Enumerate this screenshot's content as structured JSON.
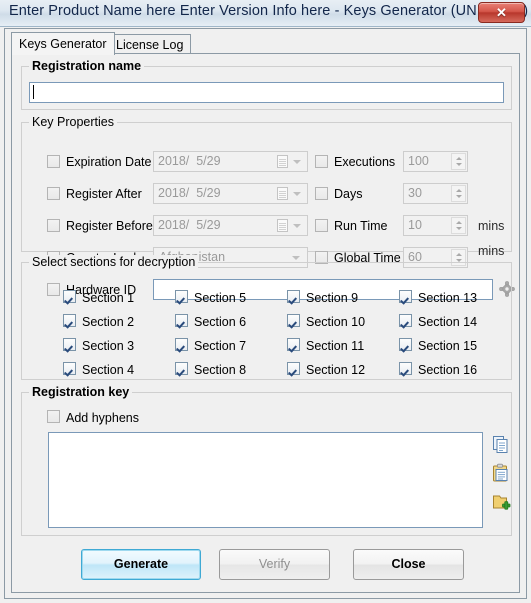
{
  "window": {
    "title": "Enter Product Name here Enter Version Info here - Keys Generator (UNICODE)",
    "close_label": "✕"
  },
  "tabs": [
    {
      "label": "Keys Generator",
      "active": true
    },
    {
      "label": "License Log",
      "active": false
    }
  ],
  "registration_name": {
    "group_title": "Registration name",
    "value": "",
    "placeholder": ""
  },
  "key_properties": {
    "group_title": "Key Properties",
    "left_rows": [
      {
        "label": "Expiration Date",
        "checked": false,
        "control": "datepicker",
        "value": "2018/  5/29"
      },
      {
        "label": "Register After",
        "checked": false,
        "control": "datepicker",
        "value": "2018/  5/29"
      },
      {
        "label": "Register Before",
        "checked": false,
        "control": "datepicker",
        "value": "2018/  5/29"
      },
      {
        "label": "Country Lock",
        "checked": false,
        "control": "combobox",
        "value": "Afghanistan"
      },
      {
        "label": "Hardware ID",
        "checked": false,
        "control": "textbox",
        "value": ""
      }
    ],
    "right_rows": [
      {
        "label": "Executions",
        "checked": false,
        "control": "spinner",
        "value": "100",
        "suffix": ""
      },
      {
        "label": "Days",
        "checked": false,
        "control": "spinner",
        "value": "30",
        "suffix": ""
      },
      {
        "label": "Run Time",
        "checked": false,
        "control": "spinner",
        "value": "10",
        "suffix": "mins"
      },
      {
        "label": "Global Time",
        "checked": false,
        "control": "spinner",
        "value": "60",
        "suffix": "mins"
      }
    ],
    "hardware_id_icon": "gear-icon"
  },
  "sections": {
    "group_title": "Select sections for decryption",
    "items": [
      {
        "label": "Section 1",
        "checked": true
      },
      {
        "label": "Section 5",
        "checked": true
      },
      {
        "label": "Section 9",
        "checked": true
      },
      {
        "label": "Section 13",
        "checked": true
      },
      {
        "label": "Section 2",
        "checked": true
      },
      {
        "label": "Section 6",
        "checked": true
      },
      {
        "label": "Section 10",
        "checked": true
      },
      {
        "label": "Section 14",
        "checked": true
      },
      {
        "label": "Section 3",
        "checked": true
      },
      {
        "label": "Section 7",
        "checked": true
      },
      {
        "label": "Section 11",
        "checked": true
      },
      {
        "label": "Section 15",
        "checked": true
      },
      {
        "label": "Section 4",
        "checked": true
      },
      {
        "label": "Section 8",
        "checked": true
      },
      {
        "label": "Section 12",
        "checked": true
      },
      {
        "label": "Section 16",
        "checked": true
      }
    ]
  },
  "registration_key": {
    "group_title": "Registration key",
    "add_hyphens_label": "Add hyphens",
    "add_hyphens_checked": false,
    "value": "",
    "side_icons": [
      {
        "name": "copy-icon"
      },
      {
        "name": "paste-icon"
      },
      {
        "name": "save-add-icon"
      }
    ]
  },
  "buttons": {
    "generate": "Generate",
    "verify": "Verify",
    "close": "Close"
  },
  "colors": {
    "accent": "#3fa9d4",
    "titlebar": "#dde7f0",
    "close": "#d4564a",
    "field_border": "#7a99b8"
  }
}
